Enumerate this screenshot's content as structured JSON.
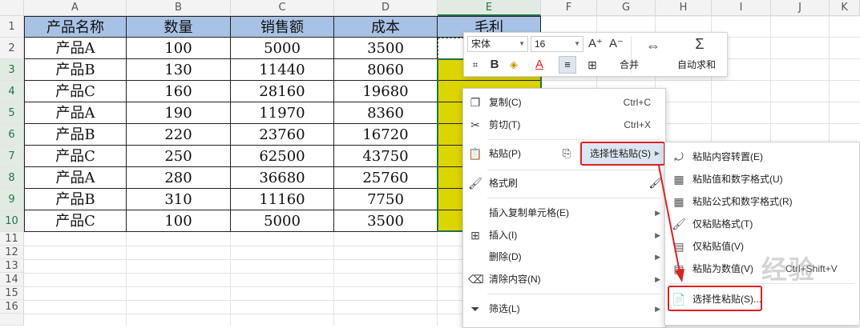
{
  "sheet": {
    "columns": [
      "A",
      "B",
      "C",
      "D",
      "E",
      "F",
      "G",
      "H",
      "I",
      "J",
      "K"
    ],
    "rows": [
      "1",
      "2",
      "3",
      "4",
      "5",
      "6",
      "7",
      "8",
      "9",
      "10",
      "11",
      "12",
      "13",
      "14",
      "15",
      "16"
    ],
    "headers": [
      "产品名称",
      "数量",
      "销售额",
      "成本",
      "毛利"
    ],
    "data": [
      [
        "产品A",
        "100",
        "5000",
        "3500"
      ],
      [
        "产品B",
        "130",
        "11440",
        "8060"
      ],
      [
        "产品C",
        "160",
        "28160",
        "19680"
      ],
      [
        "产品A",
        "190",
        "11970",
        "8360"
      ],
      [
        "产品B",
        "220",
        "23760",
        "16720"
      ],
      [
        "产品C",
        "250",
        "62500",
        "43750"
      ],
      [
        "产品A",
        "280",
        "36680",
        "25760"
      ],
      [
        "产品B",
        "310",
        "11160",
        "7750"
      ],
      [
        "产品C",
        "100",
        "5000",
        "3500"
      ]
    ],
    "colors": {
      "header_fill": "#a7c2e4",
      "selection_fill": "#dcd500",
      "accent": "#217346"
    }
  },
  "toolbar": {
    "font_name": "宋体",
    "font_size": "16",
    "grow_font": "A⁺",
    "shrink_font": "A⁻",
    "bold": "B",
    "font_color": "A",
    "merge_label": "合并",
    "autosum_label": "自动求和"
  },
  "menu": {
    "items": [
      {
        "icon": "copy-icon",
        "label": "复制(C)",
        "shortcut": "Ctrl+C"
      },
      {
        "icon": "cut-icon",
        "label": "剪切(T)",
        "shortcut": "Ctrl+X"
      },
      {
        "icon": "paste-icon",
        "label": "粘贴(P)",
        "shortcut": ""
      },
      {
        "icon": "format-painter-icon",
        "label": "格式刷",
        "shortcut": ""
      },
      {
        "icon": "",
        "label": "插入复制单元格(E)",
        "shortcut": ""
      },
      {
        "icon": "insert-icon",
        "label": "插入(I)",
        "shortcut": ""
      },
      {
        "icon": "",
        "label": "删除(D)",
        "shortcut": ""
      },
      {
        "icon": "eraser-icon",
        "label": "清除内容(N)",
        "shortcut": ""
      },
      {
        "icon": "filter-icon",
        "label": "筛选(L)",
        "shortcut": ""
      }
    ],
    "paste_special": "选择性粘贴(S)"
  },
  "submenu": {
    "items": [
      {
        "icon": "transpose-icon",
        "label": "粘贴内容转置(E)"
      },
      {
        "icon": "paste-values-icon",
        "label": "粘贴值和数字格式(U)"
      },
      {
        "icon": "paste-formula-icon",
        "label": "粘贴公式和数字格式(R)"
      },
      {
        "icon": "paste-format-icon",
        "label": "仅粘贴格式(T)"
      },
      {
        "icon": "paste-value-icon",
        "label": "仅粘贴值(V)"
      },
      {
        "icon": "paste-as-value-icon",
        "label": "粘贴为数值(V)",
        "shortcut": "Ctrl+Shift+V"
      },
      {
        "icon": "paste-special-icon",
        "label": "选择性粘贴(S)..."
      }
    ]
  },
  "watermark": "经验"
}
